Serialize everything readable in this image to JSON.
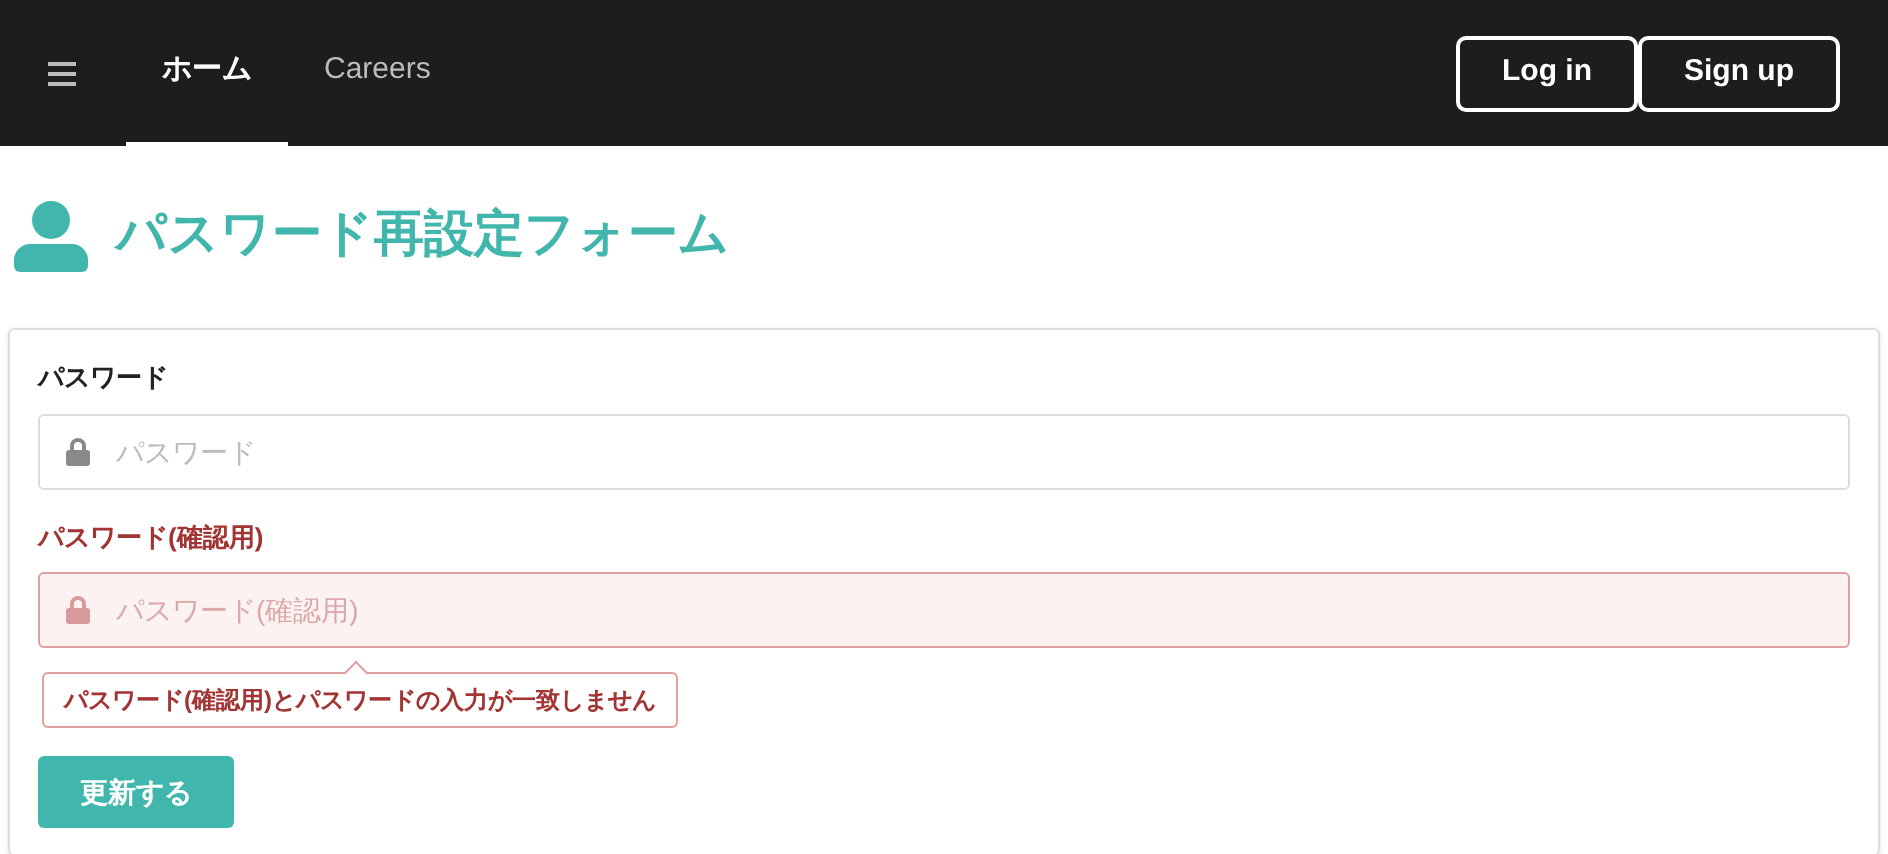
{
  "nav": {
    "tabs": [
      {
        "label": "ホーム",
        "selected": true
      },
      {
        "label": "Careers",
        "selected": false
      }
    ],
    "buttons": [
      "Log in",
      "Sign up"
    ]
  },
  "heading": "パスワード再設定フォーム",
  "form": {
    "fields": [
      {
        "label": "パスワード",
        "placeholder": "パスワード",
        "invalid": false
      },
      {
        "label": "パスワード(確認用)",
        "placeholder": "パスワード(確認用)",
        "invalid": true,
        "error": "パスワード(確認用)とパスワードの入力が一致しません"
      }
    ],
    "submit": "更新する"
  }
}
